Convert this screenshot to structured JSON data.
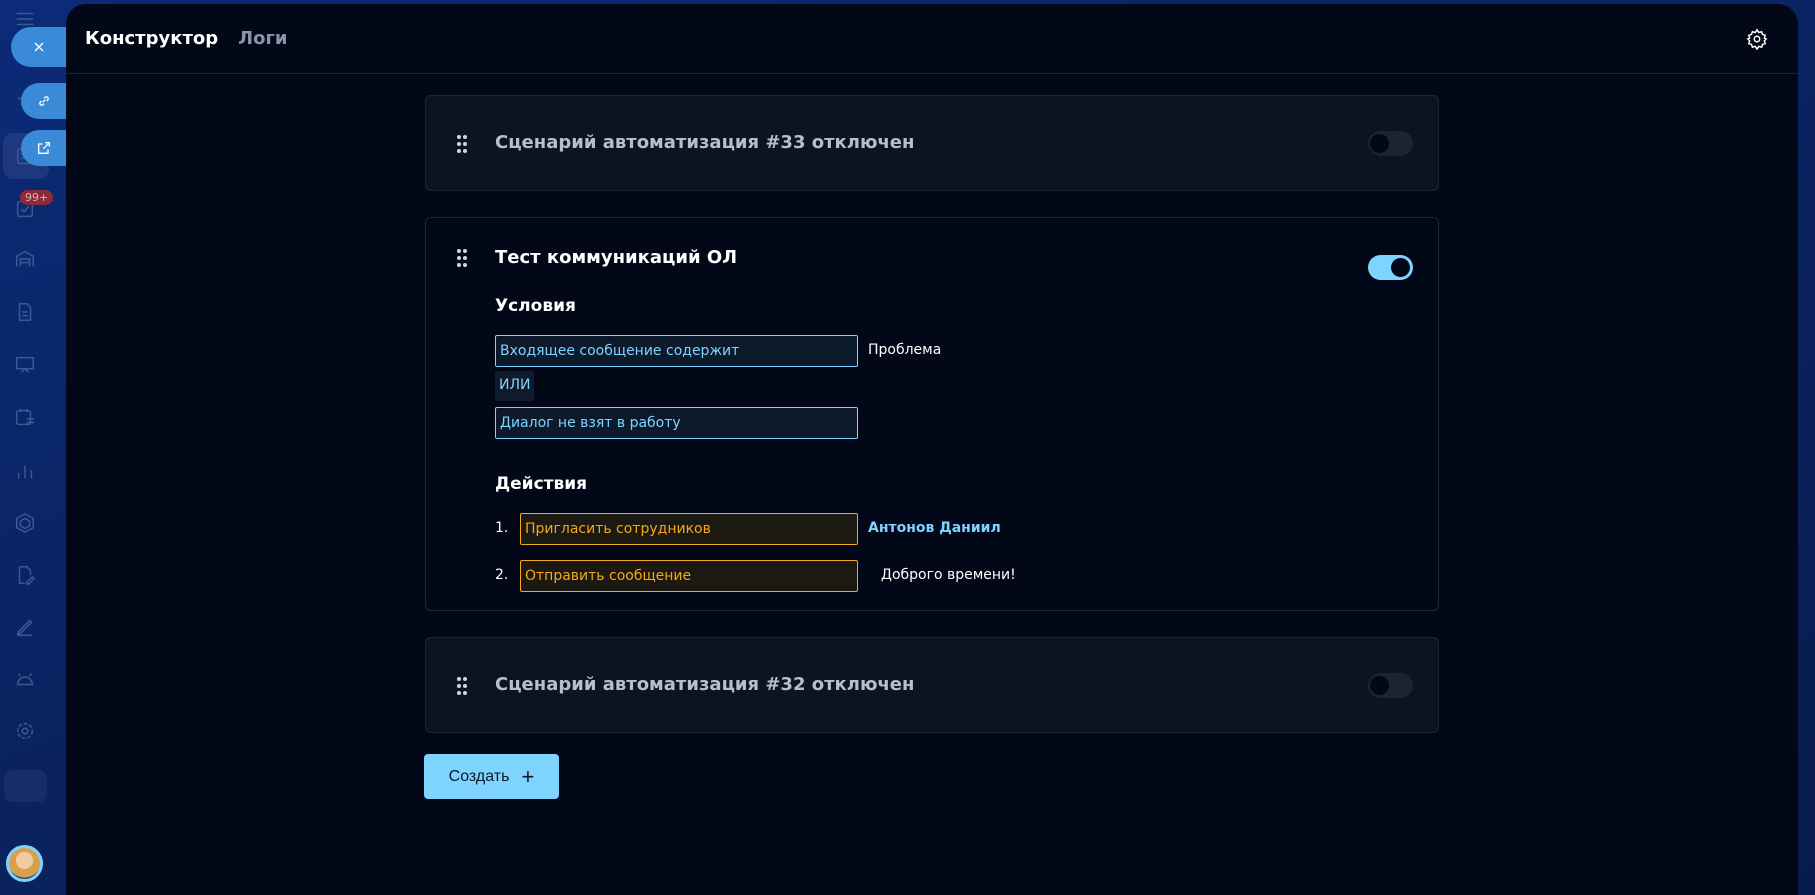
{
  "sidebar": {
    "badge": "99+"
  },
  "header": {
    "tabs": [
      {
        "label": "Конструктор"
      },
      {
        "label": "Логи"
      }
    ]
  },
  "scenarios": [
    {
      "title": "Сценарий автоматизация #33 отключен",
      "enabled": false
    },
    {
      "title": "Тест коммуникаций ОЛ",
      "enabled": true,
      "conditions_heading": "Условия",
      "conditions": [
        {
          "type": "Входящее сообщение содержит",
          "value": "Проблема"
        },
        {
          "type": "Диалог не взят в работу",
          "value": ""
        }
      ],
      "operator": "ИЛИ",
      "actions_heading": "Действия",
      "actions": [
        {
          "num": "1.",
          "type": "Пригласить сотрудников",
          "value": "Антонов Даниил"
        },
        {
          "num": "2.",
          "type": "Отправить сообщение",
          "value": "Доброго времени!"
        }
      ]
    },
    {
      "title": "Сценарий автоматизация #32 отключен",
      "enabled": false
    }
  ],
  "create_button": {
    "label": "Создать",
    "icon": "plus-icon"
  },
  "colors": {
    "accent": "#7fd3ff",
    "action": "#f5a818",
    "panel": "#020817"
  }
}
